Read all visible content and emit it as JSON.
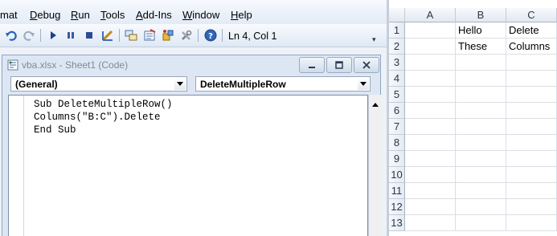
{
  "menu": {
    "items": [
      {
        "label": "mat",
        "underline": ""
      },
      {
        "label": "Debug",
        "underline": "D"
      },
      {
        "label": "Run",
        "underline": "R"
      },
      {
        "label": "Tools",
        "underline": "T"
      },
      {
        "label": "Add-Ins",
        "underline": "A"
      },
      {
        "label": "Window",
        "underline": "W"
      },
      {
        "label": "Help",
        "underline": "H"
      }
    ]
  },
  "toolbar": {
    "cursor_position": "Ln 4, Col 1",
    "icons": [
      "undo-icon",
      "redo-icon",
      "run-icon",
      "break-icon",
      "reset-icon",
      "design-mode-icon",
      "project-explorer-icon",
      "properties-window-icon",
      "object-browser-icon",
      "toolbox-icon",
      "help-icon"
    ]
  },
  "code_window": {
    "title": "vba.xlsx - Sheet1 (Code)",
    "object_combo": "(General)",
    "procedure_combo": "DeleteMultipleRow",
    "lines": [
      "Sub DeleteMultipleRow()",
      "Columns(\"B:C\").Delete",
      "End Sub"
    ]
  },
  "sheet": {
    "columns": [
      "A",
      "B",
      "C"
    ],
    "rows": [
      "1",
      "2",
      "3",
      "4",
      "5",
      "6",
      "7",
      "8",
      "9",
      "10",
      "11",
      "12",
      "13"
    ],
    "cells": {
      "B1": "Hello",
      "C1": "Delete",
      "B2": "These",
      "C2": "Columns"
    }
  },
  "colors": {
    "menubar_bg": "#e3ebf6",
    "sheet_header_bg": "#e3e9f1"
  }
}
